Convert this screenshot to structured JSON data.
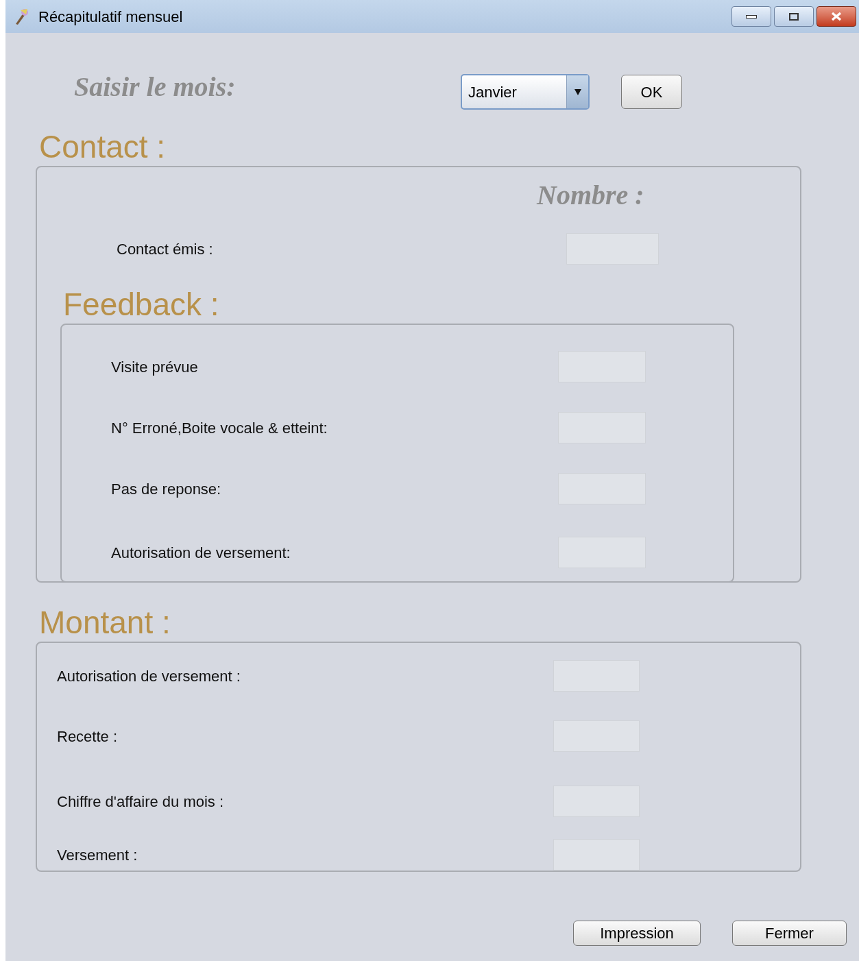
{
  "window": {
    "title": "Récapitulatif mensuel"
  },
  "month": {
    "label": "Saisir le mois:",
    "value": "Janvier",
    "ok_button": "OK"
  },
  "contact": {
    "title": "Contact :",
    "column_header": "Nombre :",
    "rows": [
      {
        "label": "Contact émis :"
      }
    ]
  },
  "feedback": {
    "title": "Feedback :",
    "rows": [
      {
        "label": "Visite prévue"
      },
      {
        "label": "N° Erroné,Boite vocale & etteint:"
      },
      {
        "label": "Pas de reponse:"
      },
      {
        "label": "Autorisation de versement:"
      }
    ]
  },
  "montant": {
    "title": "Montant :",
    "rows": [
      {
        "label": "Autorisation de versement :"
      },
      {
        "label": "Recette :"
      },
      {
        "label": "Chiffre d'affaire du mois :"
      },
      {
        "label": "Versement  :"
      }
    ]
  },
  "buttons": [
    "Impression",
    "Fermer"
  ]
}
